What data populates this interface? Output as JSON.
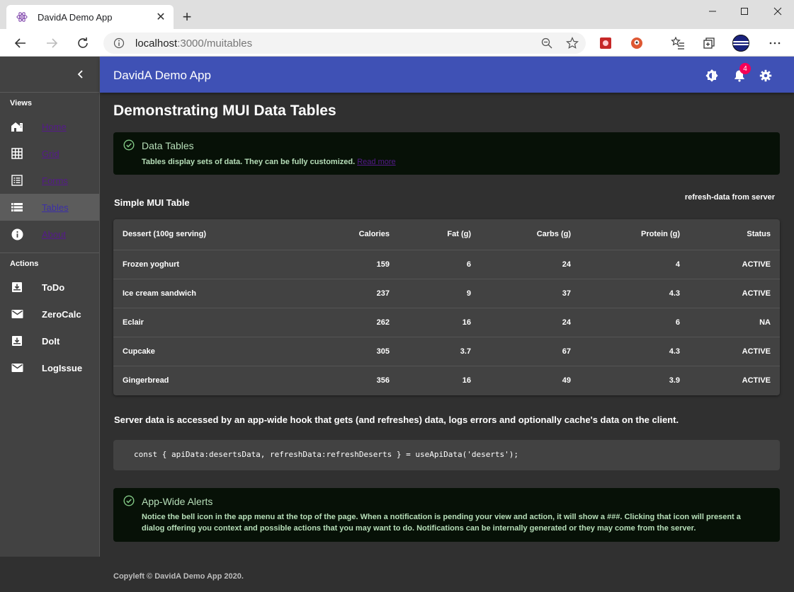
{
  "browser": {
    "tab_title": "DavidA Demo App",
    "url_host": "localhost",
    "url_rest": ":3000/muitables"
  },
  "app": {
    "title": "DavidA Demo App",
    "notification_count": "4"
  },
  "sidebar": {
    "views_title": "Views",
    "views": [
      {
        "label": "Home",
        "icon": "home-icon"
      },
      {
        "label": "Grid",
        "icon": "grid-icon"
      },
      {
        "label": "Forms",
        "icon": "list-icon"
      },
      {
        "label": "Tables",
        "icon": "table-icon"
      },
      {
        "label": "About",
        "icon": "info-icon"
      }
    ],
    "actions_title": "Actions",
    "actions": [
      {
        "label": "ToDo",
        "icon": "inbox-icon"
      },
      {
        "label": "ZeroCalc",
        "icon": "mail-icon"
      },
      {
        "label": "DoIt",
        "icon": "inbox-icon"
      },
      {
        "label": "LogIssue",
        "icon": "mail-icon"
      }
    ]
  },
  "page": {
    "title": "Demonstrating MUI Data Tables",
    "alert1": {
      "title": "Data Tables",
      "body": "Tables display sets of data. They can be fully customized.",
      "link": "Read more"
    },
    "table_title": "Simple MUI Table",
    "refresh_label": "refresh-data from server",
    "table": {
      "headers": [
        "Dessert (100g serving)",
        "Calories",
        "Fat (g)",
        "Carbs (g)",
        "Protein (g)",
        "Status"
      ],
      "rows": [
        [
          "Frozen yoghurt",
          "159",
          "6",
          "24",
          "4",
          "ACTIVE"
        ],
        [
          "Ice cream sandwich",
          "237",
          "9",
          "37",
          "4.3",
          "ACTIVE"
        ],
        [
          "Eclair",
          "262",
          "16",
          "24",
          "6",
          "NA"
        ],
        [
          "Cupcake",
          "305",
          "3.7",
          "67",
          "4.3",
          "ACTIVE"
        ],
        [
          "Gingerbread",
          "356",
          "16",
          "49",
          "3.9",
          "ACTIVE"
        ]
      ]
    },
    "note": "Server data is accessed by an app-wide hook that gets (and refreshes) data, logs errors and optionally cache's data on the client.",
    "code": "const { apiData:desertsData, refreshData:refreshDeserts } = useApiData('deserts');",
    "alert2": {
      "title": "App-Wide Alerts",
      "body": "Notice the bell icon in the app menu at the top of the page. When a notification is pending your view and action, it will show a ###. Clicking that icon will present a dialog offering you context and possible actions that you may want to do. Notifications can be internally generated or they may come from the server."
    }
  },
  "footer": "Copyleft © DavidA Demo App 2020."
}
